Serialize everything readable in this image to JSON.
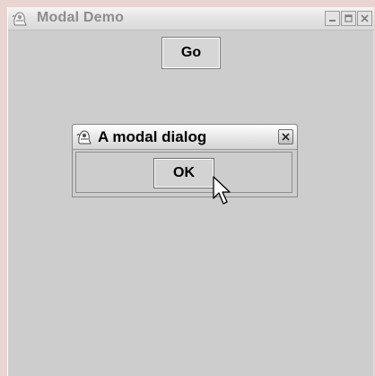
{
  "window": {
    "title": "Modal Demo",
    "app_icon": "java-duke-icon",
    "controls": [
      "minimize-icon",
      "maximize-icon",
      "close-icon"
    ]
  },
  "main": {
    "go_label": "Go"
  },
  "dialog": {
    "title": "A modal dialog",
    "icon": "java-duke-icon",
    "ok_label": "OK"
  },
  "colors": {
    "background": "#cdcdcd",
    "title_inactive": "#8d8d8d",
    "title_active": "#000000"
  },
  "cursor": "arrow-pointer"
}
